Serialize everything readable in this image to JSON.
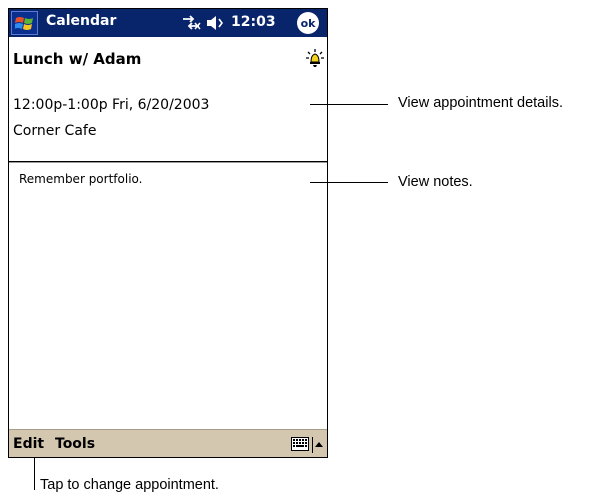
{
  "titlebar": {
    "app_title": "Calendar",
    "clock": "12:03",
    "ok_label": "ok"
  },
  "appointment": {
    "subject": "Lunch w/ Adam",
    "when": "12:00p-1:00p Fri, 6/20/2003",
    "where": "Corner Cafe",
    "notes": "Remember portfolio."
  },
  "menubar": {
    "edit_label": "Edit",
    "tools_label": "Tools"
  },
  "callouts": {
    "details": "View appointment details.",
    "notes": "View notes.",
    "edit": "Tap to change appointment."
  },
  "icons": {
    "start": "windows-flag-icon",
    "connectivity": "connectivity-arrows-icon",
    "speaker": "speaker-icon",
    "alarm": "alarm-bell-icon",
    "keyboard": "keyboard-icon"
  },
  "colors": {
    "titlebar": "#08246b",
    "menubar": "#d4c7b0"
  }
}
